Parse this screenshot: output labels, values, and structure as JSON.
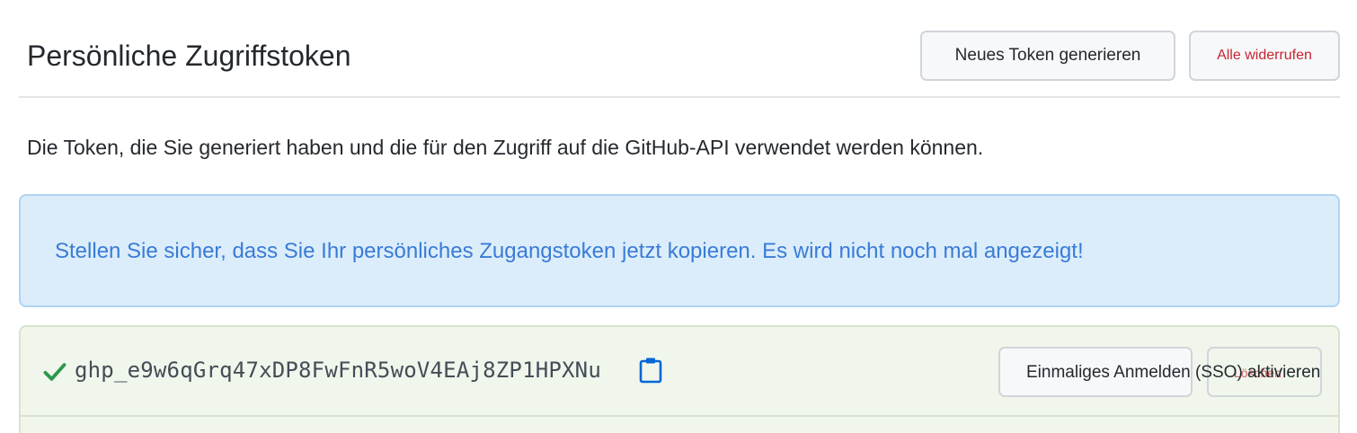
{
  "header": {
    "title": "Persönliche Zugriffstoken",
    "new_token_label": "Neues Token generieren",
    "revoke_all_label": "Alle widerrufen"
  },
  "description": "Die Token, die Sie generiert haben und die für den Zugriff auf die GitHub-API verwendet werden können.",
  "flash": {
    "message": "Stellen Sie sicher, dass Sie Ihr persönliches Zugangstoken jetzt kopieren. Es wird nicht noch mal angezeigt!"
  },
  "token": {
    "value": "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",
    "sso_label": "Einmaliges Anmelden (SSO) aktivieren",
    "delete_label": "Löschen"
  },
  "icons": {
    "check": "check-icon",
    "copy": "clipboard-icon"
  },
  "colors": {
    "flash_bg": "#dbedfb",
    "flash_text": "#3a7bd5",
    "token_bg": "#f0f6ec",
    "check": "#2c974b",
    "danger": "#cb2431",
    "copy_icon": "#0366d6"
  }
}
